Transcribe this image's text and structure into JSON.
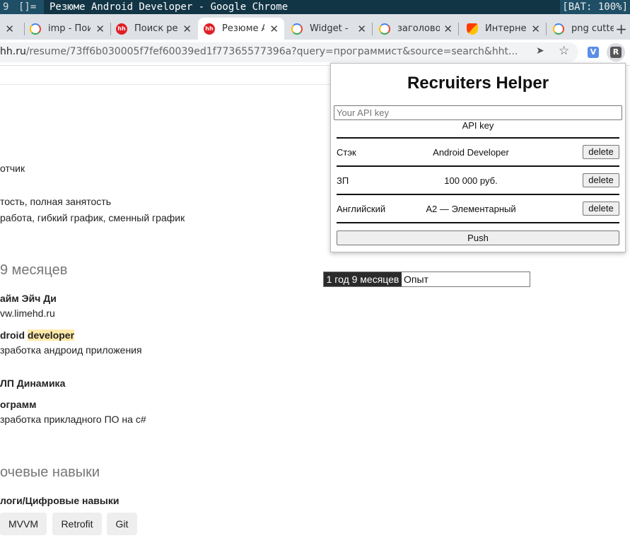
{
  "wm": {
    "workspace": "9",
    "layout": "[]=",
    "window_title": "Резюме Android Developer - Google Chrome",
    "battery": "[BAT: 100%]"
  },
  "tabs": [
    {
      "title": "imp - Пои",
      "icon": "google-g-icon"
    },
    {
      "title": "Поиск ре",
      "icon": "hh-icon"
    },
    {
      "title": "Резюме A",
      "icon": "hh-icon",
      "active": true
    },
    {
      "title": "Widget -",
      "icon": "google-g-icon"
    },
    {
      "title": "заголово",
      "icon": "google-g-icon"
    },
    {
      "title": "Интерне",
      "icon": "rainbow-icon"
    },
    {
      "title": "png cutte",
      "icon": "google-g-icon"
    }
  ],
  "toolbar": {
    "url_host": "hh.ru",
    "url_path": "/resume/73ff6b030005f7fef60039ed1f77365577396a?query=программист&source=search&hht...",
    "ext_v_label": "V",
    "ext_r_label": "R"
  },
  "page": {
    "position_tail": "отчик",
    "employment": "тость, полная занятость",
    "schedule": " работа, гибкий график, сменный график",
    "experience_heading": "9 месяцев",
    "jobs": [
      {
        "company": "айм Эйч Ди",
        "site": "vw.limehd.ru",
        "role_prefix": "droid ",
        "role_highlight": "developer",
        "desc": "зработка андроид приложения"
      },
      {
        "company": "ЛП Динамика",
        "role": "ограмм",
        "desc": "зработка прикладного ПО на c#"
      }
    ],
    "skills_heading": "очевые навыки",
    "skills_subheading": "логи/Цифровые навыки",
    "skills": [
      "MVVM",
      "Retrofit",
      "Git"
    ]
  },
  "experience_widget": {
    "badge": "1 год 9 месяцев",
    "value": "Опыт"
  },
  "popup": {
    "title": "Recruiters Helper",
    "api_placeholder": "Your API key",
    "api_label": "API key",
    "fields": [
      {
        "key": "Стэк",
        "value": "Android Developer",
        "delete": "delete"
      },
      {
        "key": "ЗП",
        "value": "100 000 руб.",
        "delete": "delete"
      },
      {
        "key": "Английский",
        "value": "A2 — Элементарный",
        "delete": "delete"
      }
    ],
    "push_label": "Push"
  }
}
